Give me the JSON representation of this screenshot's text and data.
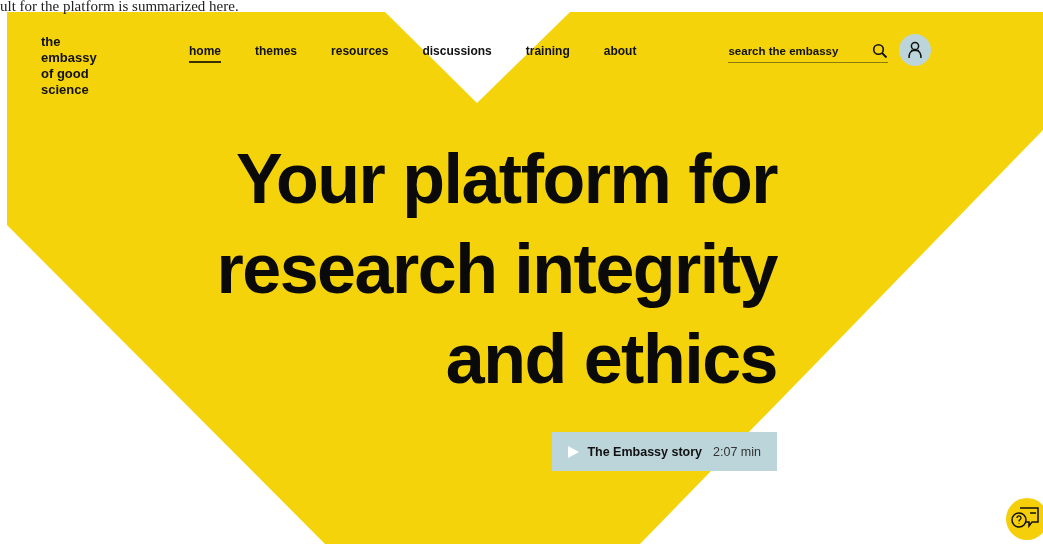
{
  "caption": "ult for the platform is summarized here.",
  "logo": "the embassy of good science",
  "nav": [
    {
      "label": "home",
      "selected": true
    },
    {
      "label": "themes",
      "selected": false
    },
    {
      "label": "resources",
      "selected": false
    },
    {
      "label": "discussions",
      "selected": false
    },
    {
      "label": "training",
      "selected": false
    },
    {
      "label": "about",
      "selected": false
    }
  ],
  "search": {
    "placeholder": "search the embassy"
  },
  "hero": {
    "lines": [
      "Your platform for",
      "research integrity",
      "and ethics"
    ]
  },
  "video": {
    "title": "The Embassy story",
    "duration": "2:07 min"
  }
}
